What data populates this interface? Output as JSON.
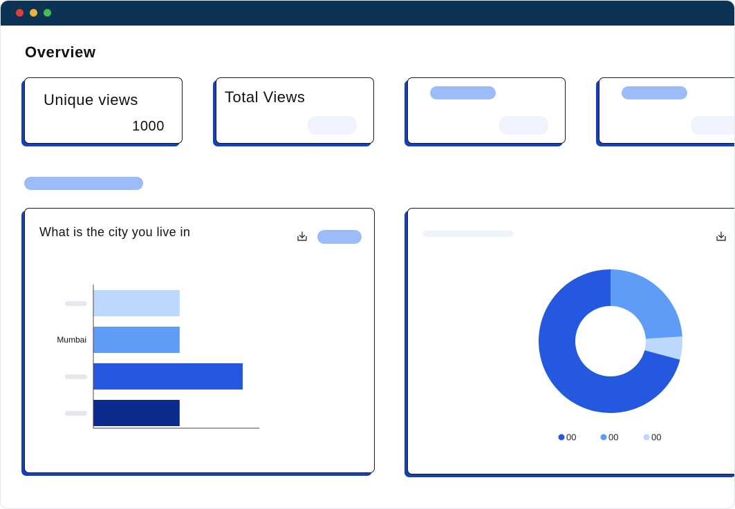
{
  "window": {
    "title_bar": {
      "dots": [
        "#e0403c",
        "#e9b23a",
        "#3fbf4f"
      ]
    }
  },
  "page": {
    "title": "Overview"
  },
  "stats": [
    {
      "label": "Unique views",
      "value": "1000"
    },
    {
      "label": "Total Views",
      "value": ""
    },
    {
      "label": "",
      "value": ""
    },
    {
      "label": "",
      "value": ""
    }
  ],
  "bar_panel": {
    "title": "What is the city you live in",
    "download_icon": "download-icon"
  },
  "donut_panel": {
    "download_icon": "download-icon"
  },
  "chart_data": [
    {
      "type": "bar",
      "orientation": "horizontal",
      "title": "What is the city you live in",
      "categories": [
        "",
        "Mumbai",
        "",
        ""
      ],
      "values": [
        52,
        52,
        90,
        52
      ],
      "colors": [
        "#bcd8fc",
        "#5e9cf7",
        "#2358df",
        "#0a2a8c"
      ],
      "xlim": [
        0,
        100
      ],
      "grid": false
    },
    {
      "type": "pie",
      "donut": true,
      "slices": [
        {
          "label": "00",
          "value": 68,
          "color": "#2358df"
        },
        {
          "label": "00",
          "value": 23,
          "color": "#5e9cf7"
        },
        {
          "label": "00",
          "value": 5,
          "color": "#bcd8fc"
        }
      ],
      "legend_position": "bottom"
    }
  ]
}
